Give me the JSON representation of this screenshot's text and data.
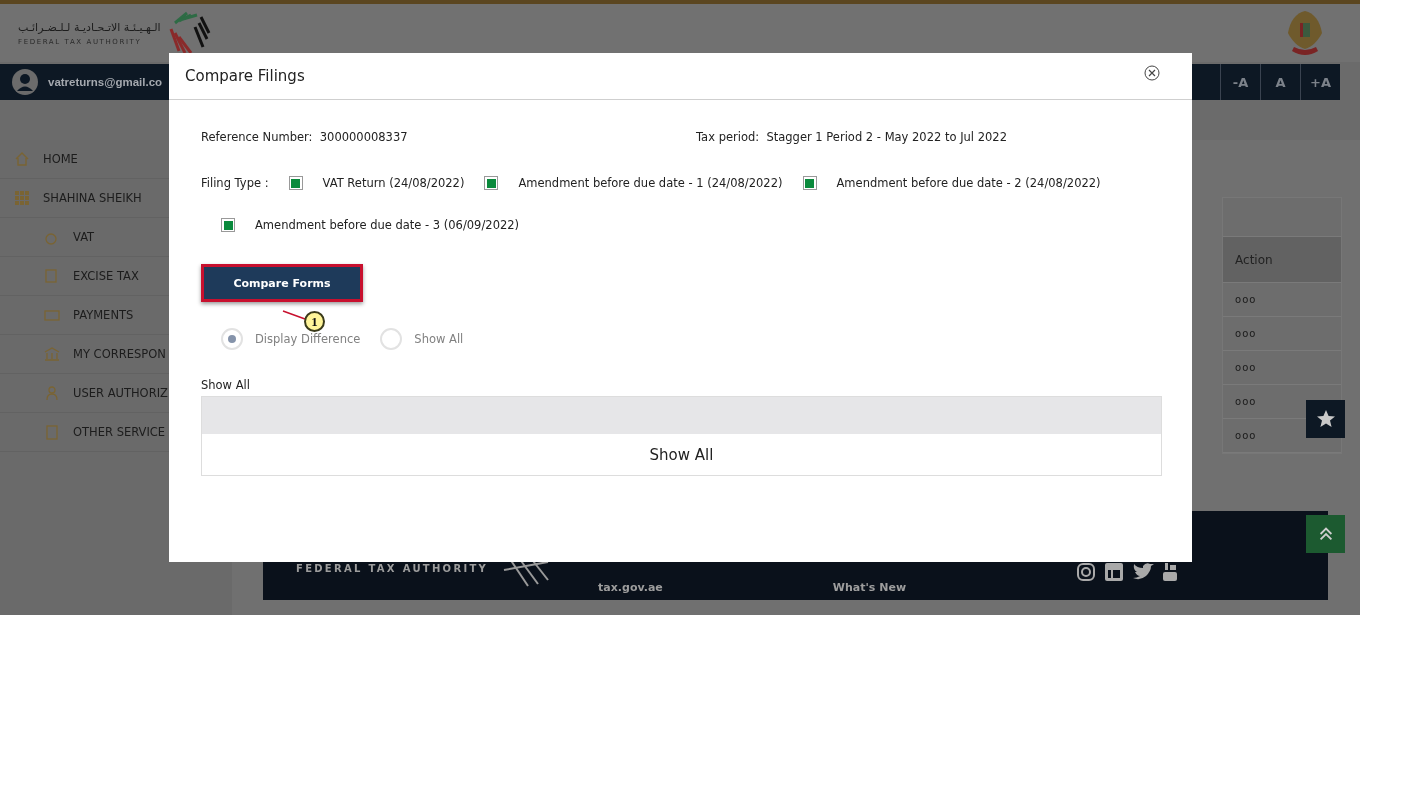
{
  "header": {
    "logo_arabic": "الـهـيـئـة الاتـحـاديـة لـلـضـرائـب",
    "logo_english": "FEDERAL TAX AUTHORITY"
  },
  "user_bar": {
    "email": "vatreturns@gmail.co",
    "font_buttons": [
      "-A",
      "A",
      "+A"
    ]
  },
  "sidebar": {
    "items": [
      {
        "label": "HOME"
      },
      {
        "label": "SHAHINA SHEIKH",
        "children": [
          {
            "label": "VAT"
          },
          {
            "label": "EXCISE TAX"
          },
          {
            "label": "PAYMENTS"
          },
          {
            "label": "MY CORRESPON"
          },
          {
            "label": "USER AUTHORIZ"
          },
          {
            "label": "OTHER SERVICE"
          }
        ]
      }
    ]
  },
  "table": {
    "columns": [
      "Action"
    ],
    "rows": [
      {
        "action": "ooo"
      },
      {
        "action": "ooo"
      },
      {
        "action": "ooo"
      },
      {
        "action": "ooo"
      },
      {
        "action": "ooo"
      }
    ]
  },
  "footer": {
    "logo_text": "FEDERAL TAX AUTHORITY",
    "links": [
      "tax.gov.ae",
      "What's New"
    ]
  },
  "modal": {
    "title": "Compare Filings",
    "reference_label": "Reference Number:",
    "reference_number": "300000008337",
    "tax_period_label": "Tax period:",
    "tax_period": "Stagger 1 Period 2 - May 2022 to Jul 2022",
    "filing_type_label": "Filing Type :",
    "filings": [
      {
        "label": "VAT Return (24/08/2022)",
        "checked": true
      },
      {
        "label": "Amendment before due date - 1 (24/08/2022)",
        "checked": true
      },
      {
        "label": "Amendment before due date - 2 (24/08/2022)",
        "checked": true
      },
      {
        "label": "Amendment before due date - 3 (06/09/2022)",
        "checked": true
      }
    ],
    "compare_button": "Compare Forms",
    "view_options": [
      {
        "label": "Display Difference",
        "selected": true
      },
      {
        "label": "Show All",
        "selected": false
      }
    ],
    "result_label": "Show All",
    "result_text": "Show All"
  },
  "callout": {
    "number": "1"
  }
}
